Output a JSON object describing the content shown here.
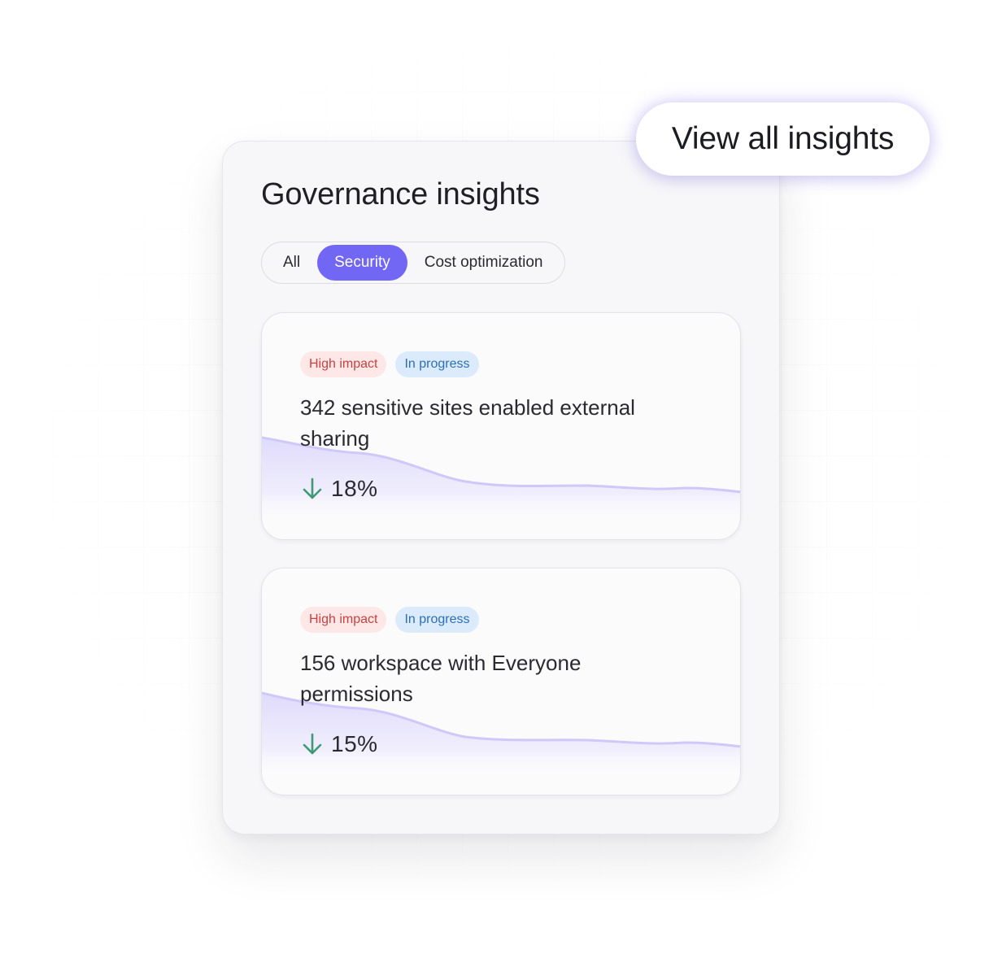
{
  "panel": {
    "title": "Governance insights"
  },
  "tabs": [
    {
      "label": "All",
      "active": false
    },
    {
      "label": "Security",
      "active": true
    },
    {
      "label": "Cost optimization",
      "active": false
    }
  ],
  "insights": [
    {
      "impact_badge": "High impact",
      "status_badge": "In progress",
      "text": "342 sensitive sites enabled external sharing",
      "trend": "down",
      "change": "18%"
    },
    {
      "impact_badge": "High impact",
      "status_badge": "In progress",
      "text": "156 workspace with Everyone permissions",
      "trend": "down",
      "change": "15%"
    }
  ],
  "view_all_button": "View all insights",
  "colors": {
    "accent": "#7266f5",
    "impact_bg": "#fde7e7",
    "impact_text": "#c9423f",
    "status_bg": "#dcebfb",
    "status_text": "#2a6fb8",
    "trend_down": "#3e9a74"
  }
}
